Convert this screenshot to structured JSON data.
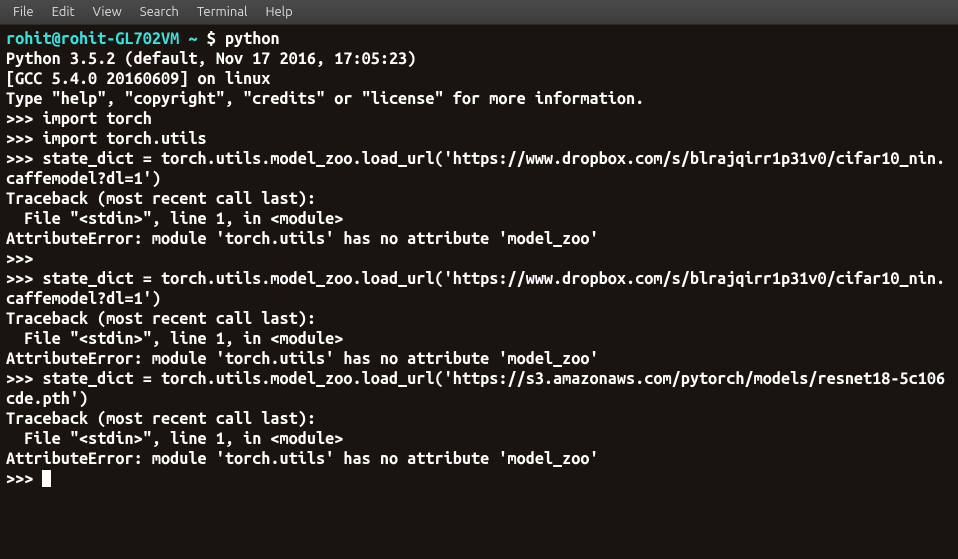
{
  "menu": {
    "file": "File",
    "edit": "Edit",
    "view": "View",
    "search": "Search",
    "terminal": "Terminal",
    "help": "Help"
  },
  "prompt": {
    "user_host": "rohit@rohit-GL702VM",
    "path": "~",
    "symbol": "$",
    "command": "python"
  },
  "lines": {
    "l0": "Python 3.5.2 (default, Nov 17 2016, 17:05:23)",
    "l1": "[GCC 5.4.0 20160609] on linux",
    "l2": "Type \"help\", \"copyright\", \"credits\" or \"license\" for more information.",
    "l3": ">>> import torch",
    "l4": ">>> import torch.utils",
    "l5": ">>> state_dict = torch.utils.model_zoo.load_url('https://www.dropbox.com/s/blrajqirr1p31v0/cifar10_nin.caffemodel?dl=1')",
    "l6": "Traceback (most recent call last):",
    "l7": "  File \"<stdin>\", line 1, in <module>",
    "l8": "AttributeError: module 'torch.utils' has no attribute 'model_zoo'",
    "l9": ">>>",
    "l10": ">>> state_dict = torch.utils.model_zoo.load_url('https://www.dropbox.com/s/blrajqirr1p31v0/cifar10_nin.caffemodel?dl=1')",
    "l11": "Traceback (most recent call last):",
    "l12": "  File \"<stdin>\", line 1, in <module>",
    "l13": "AttributeError: module 'torch.utils' has no attribute 'model_zoo'",
    "l14": ">>> state_dict = torch.utils.model_zoo.load_url('https://s3.amazonaws.com/pytorch/models/resnet18-5c106cde.pth')",
    "l15": "Traceback (most recent call last):",
    "l16": "  File \"<stdin>\", line 1, in <module>",
    "l17": "AttributeError: module 'torch.utils' has no attribute 'model_zoo'",
    "l18": ">>> "
  }
}
